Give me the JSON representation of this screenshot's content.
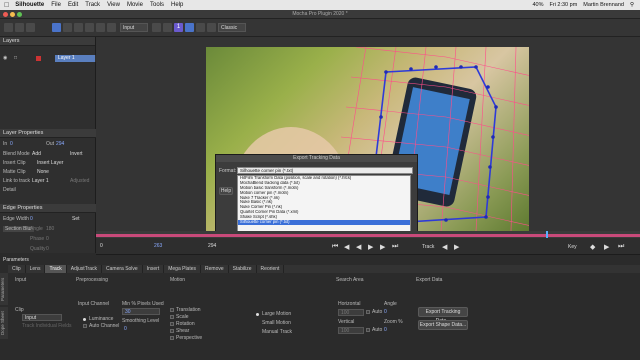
{
  "menubar": {
    "app": "Silhouette",
    "items": [
      "File",
      "Edit",
      "Track",
      "View",
      "Movie",
      "Tools",
      "Help"
    ],
    "right_status": "40%",
    "clock": "Fri 2:30 pm",
    "user": "Martin Brennand"
  },
  "window": {
    "title": "Mocha Pro Plugin 2020 *"
  },
  "toolbar": {
    "input_select": "Input",
    "view_select": "Classic",
    "badge": "1"
  },
  "layers": {
    "header": "Layers",
    "layer_name": "Layer 1"
  },
  "layer_properties": {
    "header": "Layer Properties",
    "in_label": "In",
    "in_value": "0",
    "out_label": "Out",
    "out_value": "294",
    "blend_mode_label": "Blend Mode",
    "blend_mode_value": "Add",
    "invert_label": "Invert",
    "insert_clip_label": "Insert Clip",
    "insert_clip_value": "Insert Layer",
    "matte_clip_label": "Matte Clip",
    "matte_clip_value": "None",
    "link_label": "Link to track",
    "link_value": "Layer 1",
    "adjusted": "Adjusted",
    "detail_label": "Detail"
  },
  "edge_properties": {
    "header": "Edge Properties",
    "edge_width_label": "Edge Width",
    "edge_width_value": "0",
    "set_label": "Set",
    "section_blur": "Section Blur",
    "angle_label": "Angle",
    "angle_value": "180",
    "phase_label": "Phase",
    "phase_value": "0",
    "quality_label": "Quality",
    "quality_value": "0"
  },
  "dialog": {
    "title": "Export Tracking Data",
    "format_label": "Format:",
    "format_value": "Silhouette corner pin (*.txt)",
    "help_label": "Help",
    "options": [
      "HitFilm Transform Data (position, scale and rotation) (*.hfcs)",
      "MochaBlend tracking data (*.txt)",
      "Motion basic transform (*.motn)",
      "Motion corner pin (*.motn)",
      "Nuke 7 Tracker (*.nk)",
      "Nuke Basic (*.nk)",
      "Nuke Corner Pin (*.nk)",
      "Quartet Corner Pin Data (*.xml)",
      "Shake Script (*.shk)",
      "Silhouette corner pin (*.txt)"
    ],
    "selected_index": 9
  },
  "transport": {
    "frame_start": "0",
    "frame_in": "263",
    "frame_out": "294",
    "track_label": "Track",
    "key_label": "Key"
  },
  "parameters": {
    "header": "Parameters",
    "tabs": [
      "Clip",
      "Lens",
      "Track",
      "AdjustTrack",
      "Camera Solve",
      "Insert",
      "Mega Plates",
      "Remove",
      "Stabilize",
      "Reorient"
    ],
    "active_tab": "Track",
    "side_tabs": [
      "Parameters",
      "Dope Sheet"
    ],
    "input_heading": "Input",
    "preprocessing_heading": "Preprocessing",
    "motion_heading": "Motion",
    "search_area_heading": "Search Area",
    "export_heading": "Export Data",
    "clip_label": "Clip",
    "clip_value": "Input",
    "track_individual": "Track Individual Fields",
    "input_channel_label": "Input Channel",
    "luminance_label": "Luminance",
    "auto_channel_label": "Auto Channel",
    "min_pixels_label": "Min % Pixels Used",
    "min_pixels_value": "30",
    "smoothing_label": "Smoothing Level",
    "smoothing_value": "0",
    "motion_options": [
      "Translation",
      "Scale",
      "Rotation",
      "Shear",
      "Perspective"
    ],
    "large_motion": "Large Motion",
    "small_motion": "Small Motion",
    "manual_track": "Manual Track",
    "horizontal_label": "Horizontal",
    "vertical_label": "Vertical",
    "auto_label": "Auto",
    "horizontal_value": "100",
    "vertical_value": "100",
    "angle_label": "Angle",
    "angle_value": "0",
    "zoom_label": "Zoom %",
    "zoom_value": "0",
    "export_tracking_btn": "Export Tracking Data...",
    "export_shape_btn": "Export Shape Data..."
  }
}
